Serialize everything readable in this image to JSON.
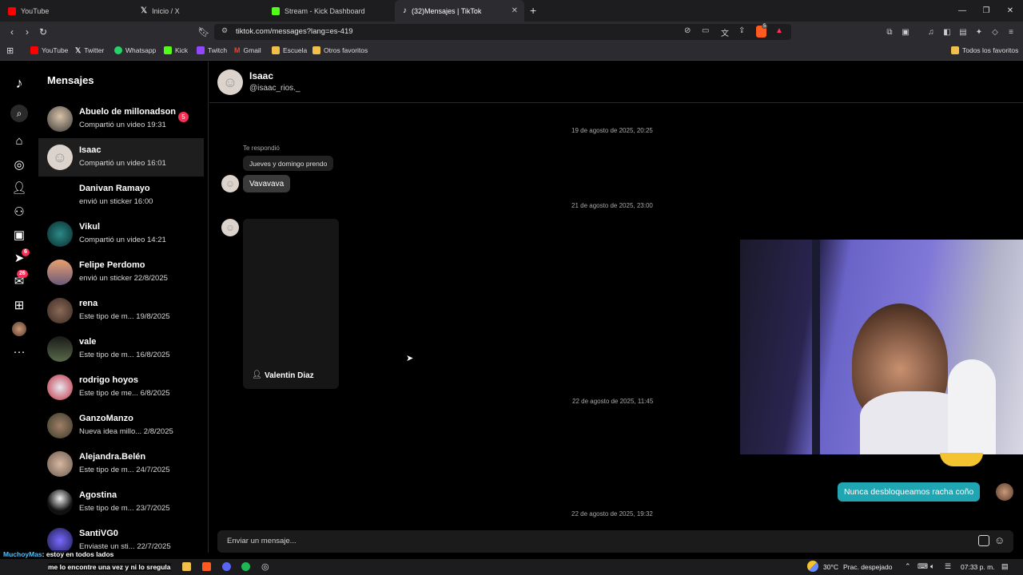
{
  "browser": {
    "tabs": [
      {
        "title": "YouTube",
        "icon": "youtube-icon",
        "color": "#ff0000"
      },
      {
        "title": "Inicio / X",
        "icon": "x-icon",
        "color": "#ffffff"
      },
      {
        "title": "Stream - Kick Dashboard",
        "icon": "kick-icon",
        "color": "#53fc18"
      },
      {
        "title": "(32)Mensajes | TikTok",
        "icon": "tiktok-icon",
        "color": "#ffffff"
      }
    ],
    "url": "tiktok.com/messages?lang=es-419",
    "bookmarks": [
      "YouTube",
      "Twitter",
      "Whatsapp",
      "Kick",
      "Twitch",
      "Gmail",
      "Escuela",
      "Otros favoritos"
    ],
    "all_bookmarks": "Todos los favoritos",
    "shield_badge": "5"
  },
  "rail": {
    "badges": {
      "inbox": "6",
      "messages": "26"
    }
  },
  "conversations": {
    "title": "Mensajes",
    "items": [
      {
        "name": "Abuelo de millonadson",
        "preview": "Compartió un video 19:31",
        "badge": "5"
      },
      {
        "name": "Isaac",
        "preview": "Compartió un video 16:01"
      },
      {
        "name": "Danivan Ramayo",
        "preview": "envió un sticker 16:00"
      },
      {
        "name": "Vikul",
        "preview": "Compartió un video 14:21"
      },
      {
        "name": "Felipe Perdomo",
        "preview": "envió un sticker 22/8/2025"
      },
      {
        "name": "rena",
        "preview": "Este tipo de m...   19/8/2025"
      },
      {
        "name": "vale",
        "preview": "Este tipo de m...   16/8/2025"
      },
      {
        "name": "rodrigo hoyos",
        "preview": "Este tipo de me...   6/8/2025"
      },
      {
        "name": "GanzoManzo",
        "preview": "Nueva idea millo...  2/8/2025"
      },
      {
        "name": "Alejandra.Belén",
        "preview": "Este tipo de m...   24/7/2025"
      },
      {
        "name": "Agostina",
        "preview": "Este tipo de m...   23/7/2025"
      },
      {
        "name": "SantiVG0",
        "preview": "Enviaste un sti...   22/7/2025"
      }
    ]
  },
  "chat": {
    "name": "Isaac",
    "handle": "@isaac_rios._",
    "ts1": "19 de agosto de 2025, 20:25",
    "replied_label": "Te respondió",
    "quoted": "Jueves y domingo prendo",
    "msg1": "Vavavava",
    "ts2": "21 de agosto de 2025, 23:00",
    "video_author": "Valentin Diaz",
    "ts3": "22 de agosto de 2025, 11:45",
    "sent_msg": "Nunca desbloqueamos racha coño",
    "ts4": "22 de agosto de 2025, 19:32",
    "input_placeholder": "Enviar un mensaje..."
  },
  "overlay": {
    "chat_line1_user": "MuchoyMas",
    "chat_line1": ": estoy en todos lados",
    "chat_line2": "me lo encontre una vez y ni lo sregula"
  },
  "taskbar": {
    "weather": "30°C",
    "weather_desc": "Prac. despejado",
    "time": "07:33 p. m."
  },
  "colors": {
    "accent": "#fe2c55",
    "sent_bubble": "#20a5b3"
  }
}
